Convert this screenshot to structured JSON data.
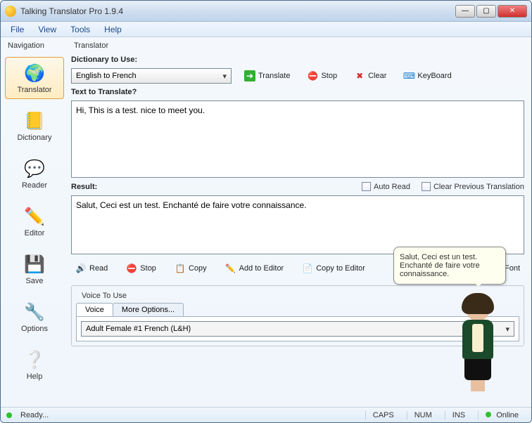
{
  "window": {
    "title": "Talking Translator Pro 1.9.4"
  },
  "menubar": [
    "File",
    "View",
    "Tools",
    "Help"
  ],
  "nav": {
    "title": "Navigation",
    "items": [
      {
        "label": "Translator",
        "icon": "🌍",
        "selected": true
      },
      {
        "label": "Dictionary",
        "icon": "📒",
        "selected": false
      },
      {
        "label": "Reader",
        "icon": "💬",
        "selected": false
      },
      {
        "label": "Editor",
        "icon": "✏️",
        "selected": false
      },
      {
        "label": "Save",
        "icon": "💾",
        "selected": false
      },
      {
        "label": "Options",
        "icon": "🔧",
        "selected": false
      },
      {
        "label": "Help",
        "icon": "❔",
        "selected": false
      }
    ]
  },
  "translator": {
    "title": "Translator",
    "dict_label": "Dictionary to Use:",
    "dict_selected": "English to French",
    "actions": {
      "translate": "Translate",
      "stop": "Stop",
      "clear": "Clear",
      "keyboard": "KeyBoard"
    },
    "input_label": "Text to Translate?",
    "input_text": "Hi, This is a test. nice to meet you.",
    "result_label": "Result:",
    "auto_read": "Auto Read",
    "clear_prev": "Clear Previous Translation",
    "result_text": "Salut, Ceci est un test. Enchanté de faire votre connaissance.",
    "result_actions": {
      "read": "Read",
      "stop": "Stop",
      "copy": "Copy",
      "add_to_editor": "Add to Editor",
      "copy_to_editor": "Copy to Editor",
      "font": "Font"
    }
  },
  "voice": {
    "group_title": "Voice To Use",
    "tabs": {
      "voice": "Voice",
      "more": "More Options..."
    },
    "selected": "Adult Female #1 French (L&H)"
  },
  "bubble": "Salut, Ceci est un test. Enchanté de faire votre connaissance.",
  "status": {
    "ready": "Ready...",
    "caps": "CAPS",
    "num": "NUM",
    "ins": "INS",
    "online": "Online"
  }
}
